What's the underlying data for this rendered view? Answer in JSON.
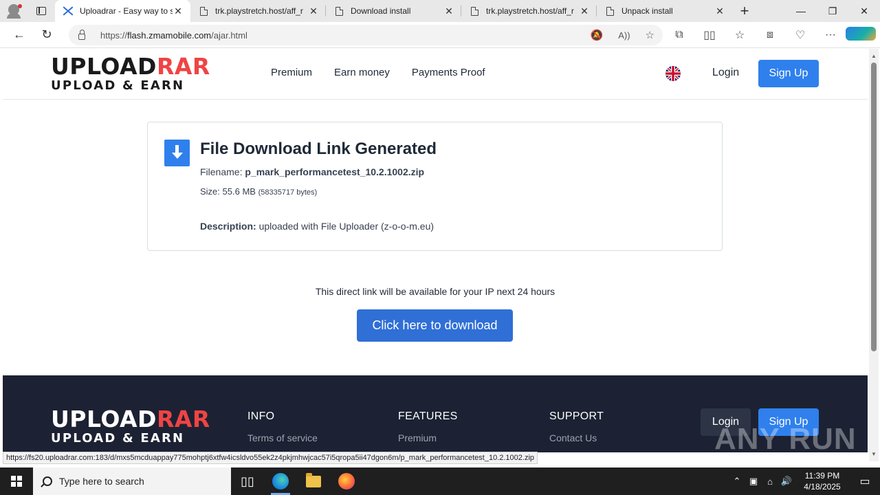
{
  "browser": {
    "tabs": [
      {
        "title": "Uploadrar - Easy way to s",
        "active": true
      },
      {
        "title": "trk.playstretch.host/aff_r",
        "active": false
      },
      {
        "title": "Download install",
        "active": false
      },
      {
        "title": "trk.playstretch.host/aff_r",
        "active": false
      },
      {
        "title": "Unpack install",
        "active": false
      }
    ],
    "url_scheme": "https://",
    "url_host": "flash.zmamobile.com",
    "url_path": "/ajar.html"
  },
  "header": {
    "logo_line1_a": "UPLOAD",
    "logo_line1_b": "RAR",
    "logo_line2": "UPLOAD & EARN",
    "nav": [
      "Premium",
      "Earn money",
      "Payments Proof"
    ],
    "login": "Login",
    "signup": "Sign Up"
  },
  "file": {
    "title": "File Download Link Generated",
    "filename_label": "Filename:",
    "filename": "p_mark_performancetest_10.2.1002.zip",
    "size_label": "Size:",
    "size": "55.6 MB",
    "size_bytes": "(58335717 bytes)",
    "description_label": "Description:",
    "description": "uploaded with File Uploader (z-o-o-m.eu)"
  },
  "download": {
    "availability": "This direct link will be available for your IP next 24 hours",
    "button": "Click here to download"
  },
  "footer": {
    "info_heading": "INFO",
    "info_link": "Terms of service",
    "features_heading": "FEATURES",
    "features_link": "Premium",
    "support_heading": "SUPPORT",
    "support_link": "Contact Us",
    "login": "Login",
    "signup": "Sign Up",
    "watermark": "ANY RUN"
  },
  "status_url": "https://fs20.uploadrar.com:183/d/mxs5mcduappay775mohptj6xtfw4icsldvo55ek2z4pkjmhwjcac57i5qropa5ii47dgon6m/p_mark_performancetest_10.2.1002.zip",
  "taskbar": {
    "search_placeholder": "Type here to search",
    "time": "11:39 PM",
    "date": "4/18/2025"
  },
  "colors": {
    "accent": "#2f80ed",
    "logo_red": "#ef4444",
    "footer_bg": "#1c2233"
  }
}
